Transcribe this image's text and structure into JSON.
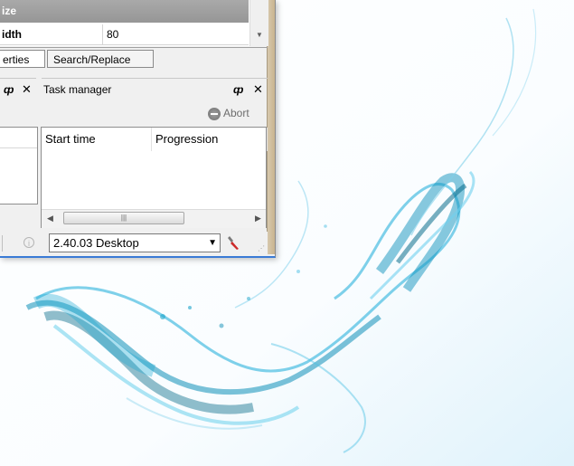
{
  "property_grid": {
    "section_label": "ize",
    "row": {
      "name": "idth",
      "value": "80"
    }
  },
  "tabs": [
    {
      "label": "erties",
      "active": true
    },
    {
      "label": "Search/Replace",
      "active": false
    }
  ],
  "left_panel": {
    "float_icon": "float-icon",
    "close_icon": "close-icon"
  },
  "task_manager": {
    "title": "Task manager",
    "abort_label": "Abort",
    "columns": [
      "Start time",
      "Progression"
    ],
    "rows": []
  },
  "status_bar": {
    "version": "2.40.03 Desktop",
    "icons": [
      "info-icon",
      "wrench-icon"
    ]
  },
  "colors": {
    "accent": "#3a7bd5",
    "ink_primary": "#1aa3c9",
    "ink_dark": "#0a6e8c"
  }
}
